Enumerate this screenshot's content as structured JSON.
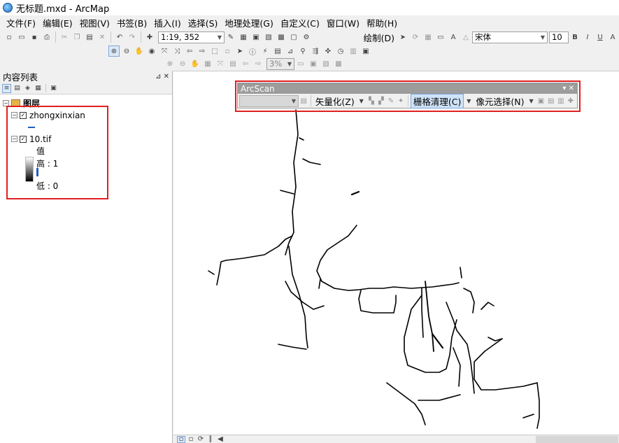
{
  "window": {
    "title": "无标题.mxd - ArcMap"
  },
  "menu": [
    "文件(F)",
    "编辑(E)",
    "视图(V)",
    "书签(B)",
    "插入(I)",
    "选择(S)",
    "地理处理(G)",
    "自定义(C)",
    "窗口(W)",
    "帮助(H)"
  ],
  "toolbar": {
    "scale": "1:19, 352",
    "draw_label": "绘制(D)",
    "font_name": "宋体",
    "font_size": "10",
    "bold": "B",
    "italic": "I",
    "underline": "U",
    "zoom_percent": "3%"
  },
  "toc": {
    "title": "内容列表",
    "root_label": "图层",
    "layers": [
      {
        "name": "zhongxinxian",
        "checked": true
      },
      {
        "name": "10.tif",
        "checked": true,
        "legend_title": "值",
        "high": "高 : 1",
        "low": "低 : 0"
      }
    ]
  },
  "arcscan": {
    "title": "ArcScan",
    "vectorize_label": "矢量化(Z)",
    "raster_cleanup_label": "栅格清理(C)",
    "cell_selection_label": "像元选择(N)"
  },
  "colors": {
    "highlight": "#e02020",
    "legend_line": "#1f5fbf"
  }
}
